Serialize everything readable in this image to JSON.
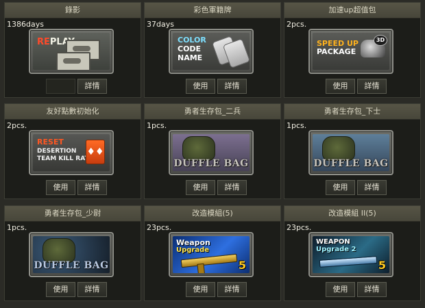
{
  "buttons": {
    "use": "使用",
    "detail": "詳情"
  },
  "cards": [
    {
      "title": "錄影",
      "count": "1386days",
      "item": {
        "name": "replay",
        "line1a": "RE",
        "line1b": "PLAY"
      },
      "has_use": false
    },
    {
      "title": "彩色軍籍牌",
      "count": "37days",
      "item": {
        "name": "color-code-name",
        "lines": [
          "COLOR",
          "CODE",
          "NAME"
        ]
      },
      "has_use": true
    },
    {
      "title": "加速up超值包",
      "count": "2pcs.",
      "item": {
        "name": "speed-up-package",
        "lines": [
          "SPEED UP",
          "PACKAGE"
        ],
        "badge": "3D"
      },
      "has_use": true
    },
    {
      "title": "友好點數初始化",
      "count": "2pcs.",
      "item": {
        "name": "reset-desertion",
        "lines": [
          "RESET",
          "DESERTION",
          "TEAM KILL RATE"
        ]
      },
      "has_use": true
    },
    {
      "title": "勇者生存包_二兵",
      "count": "1pcs.",
      "item": {
        "name": "duffle-bag-purple",
        "text": "DUFFLE BAG"
      },
      "has_use": true
    },
    {
      "title": "勇者生存包_下士",
      "count": "1pcs.",
      "item": {
        "name": "duffle-bag-blue",
        "text": "DUFFLE BAG"
      },
      "has_use": true
    },
    {
      "title": "勇者生存包_少尉",
      "count": "1pcs.",
      "item": {
        "name": "duffle-bag-stars",
        "text": "DUFFLE BAG"
      },
      "has_use": true
    },
    {
      "title": "改造模組(5)",
      "count": "23pcs.",
      "item": {
        "name": "weapon-upgrade",
        "lines": [
          "Weapon",
          "Upgrade"
        ],
        "num": "5"
      },
      "has_use": true
    },
    {
      "title": "改造模組 II(5)",
      "count": "23pcs.",
      "item": {
        "name": "weapon-upgrade-2",
        "lines": [
          "WEAPON",
          "Upgrade 2"
        ],
        "num": "5"
      },
      "has_use": true
    }
  ]
}
